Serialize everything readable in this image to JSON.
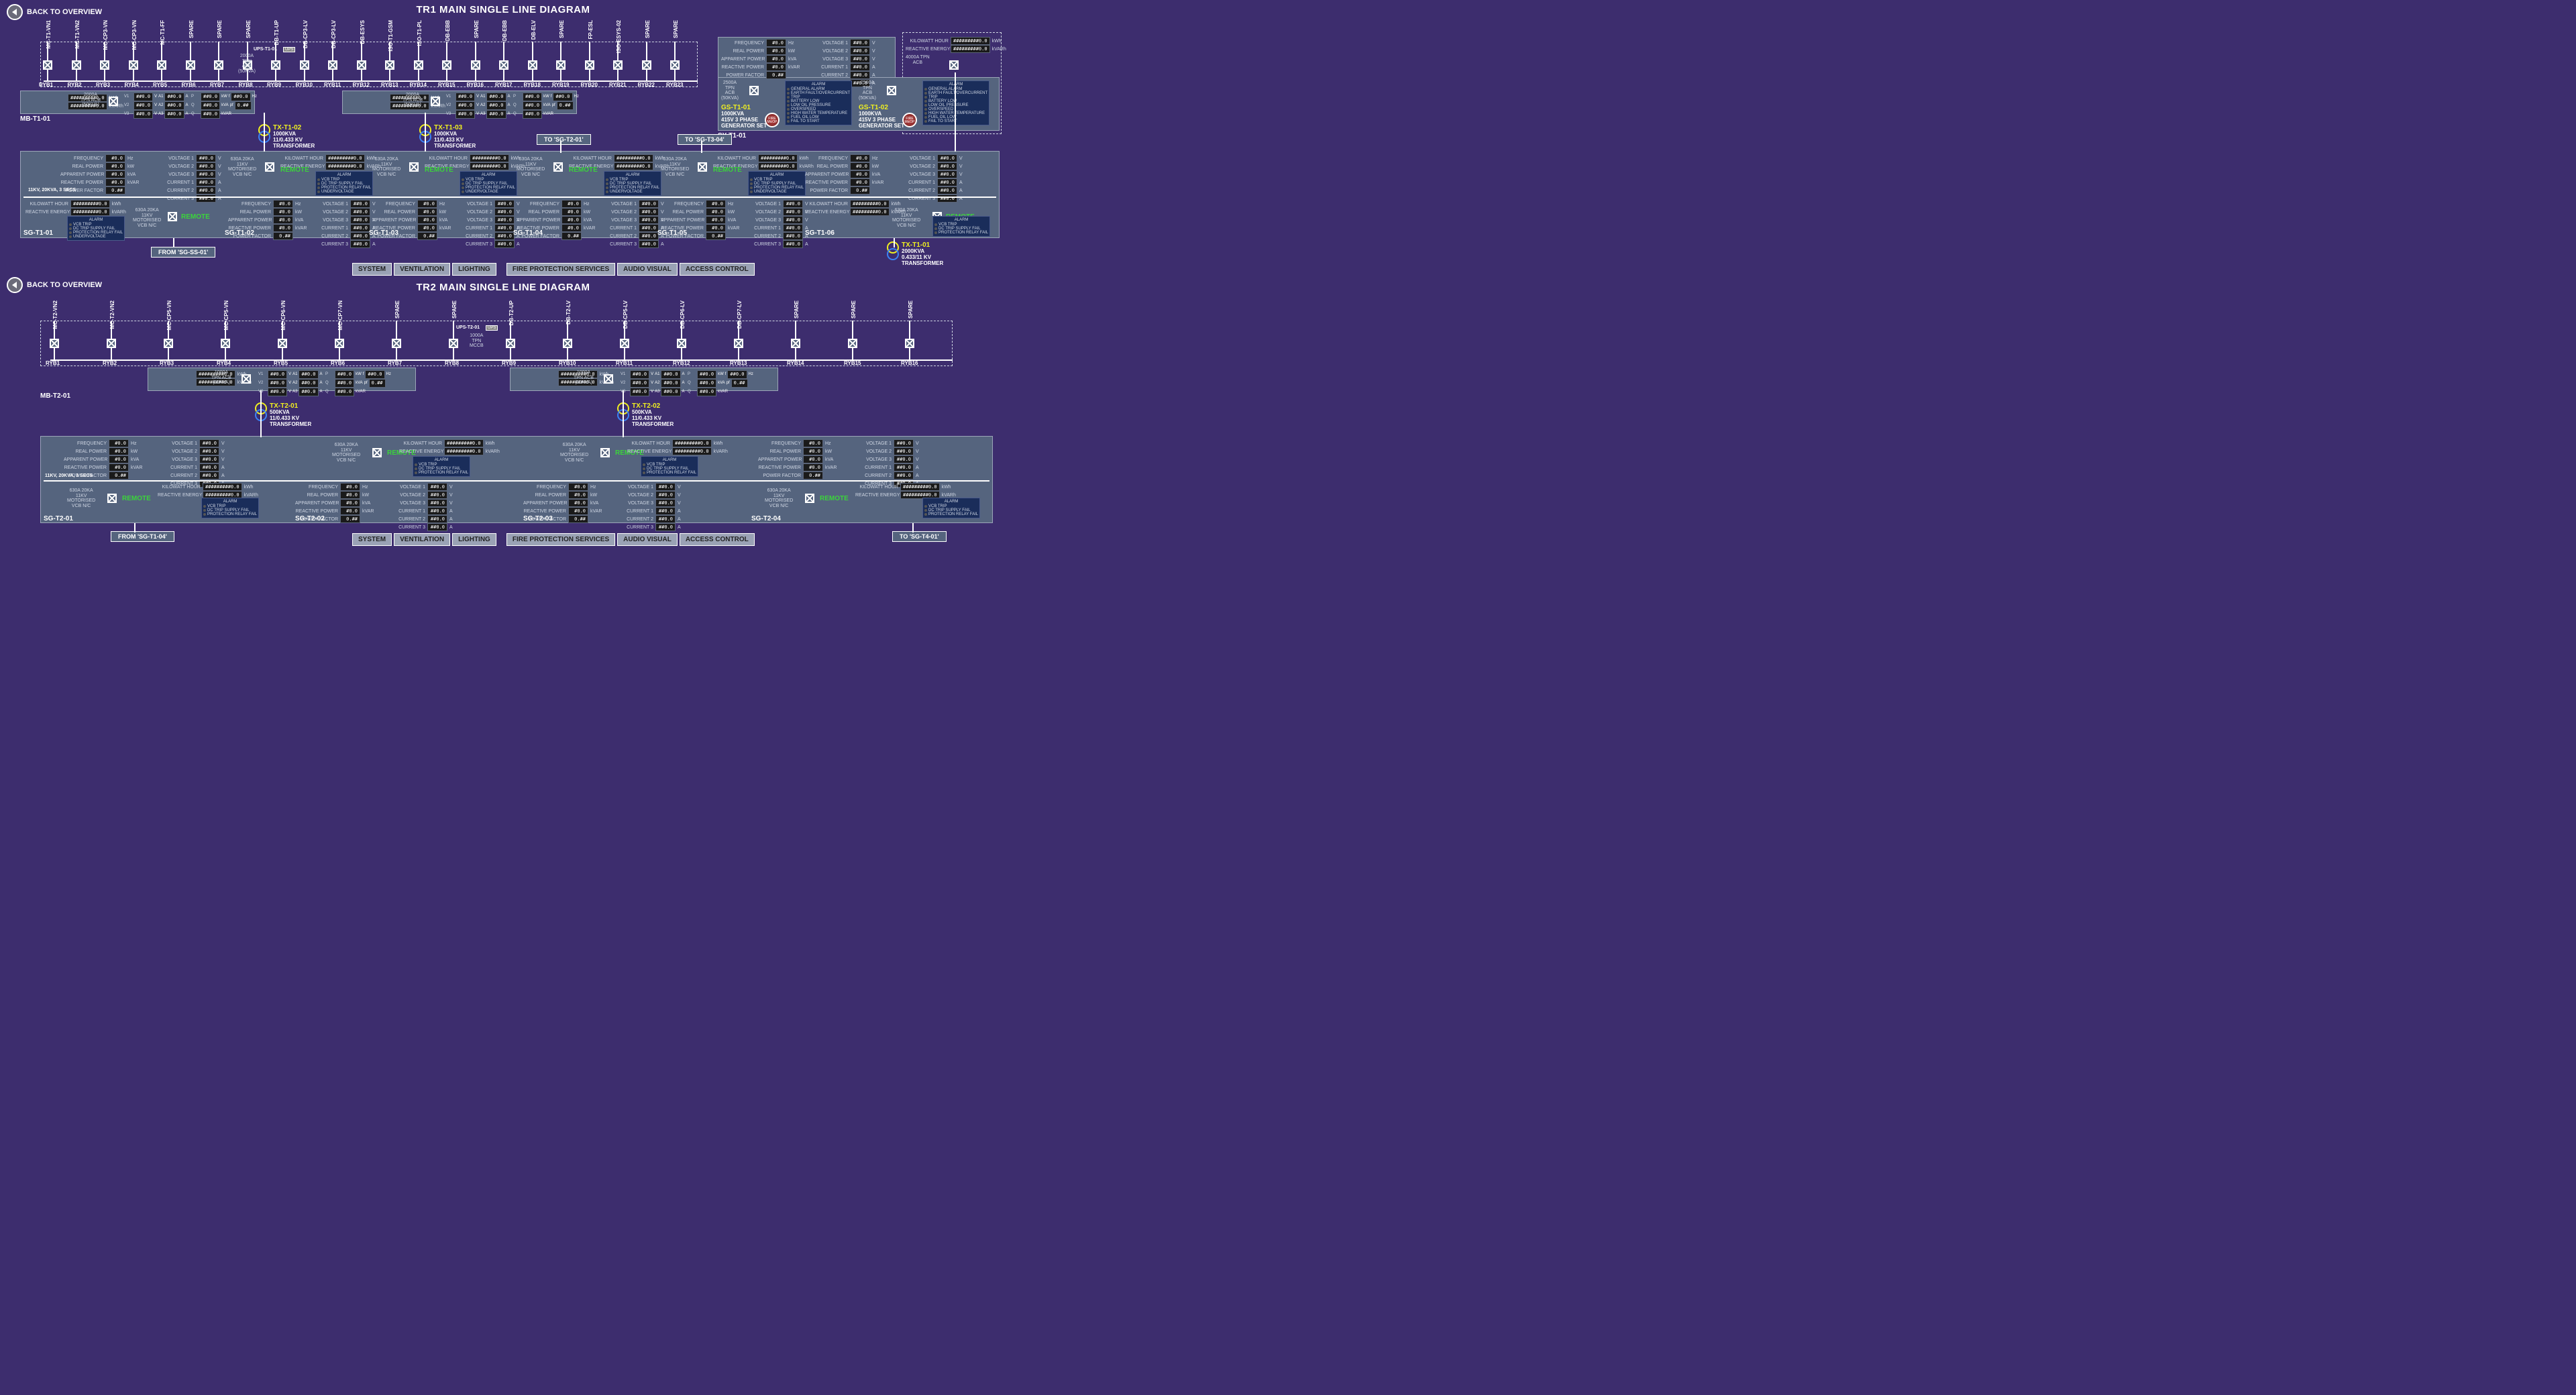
{
  "back_label": "BACK TO OVERVIEW",
  "titles": {
    "tr1": "TR1 MAIN SINGLE LINE DIAGRAM",
    "tr2": "TR2 MAIN SINGLE LINE DIAGRAM"
  },
  "nav": [
    "SYSTEM",
    "VENTILATION",
    "LIGHTING",
    "FIRE PROTECTION SERVICES",
    "AUDIO VISUAL",
    "ACCESS CONTROL"
  ],
  "feeders_tr1": [
    "MC-T1-VN1",
    "MC-T1-VN2",
    "MC-CP3-VN",
    "MC-CP3-VN",
    "MC-T1-FF",
    "SPARE",
    "SPARE",
    "SPARE",
    "DB-T1-UP",
    "DB-CP3-LV",
    "DB-CP3-LV",
    "DB-ESYS",
    "ISO-T1-GSM",
    "ISO-T1-PL",
    "DB-EBB",
    "SPARE",
    "DB-EBB",
    "DB-ELV",
    "SPARE",
    "FP-ESL",
    "ISO-ESYS-02",
    "SPARE",
    "SPARE"
  ],
  "ryb_tr1": [
    "RYB1",
    "RYB2",
    "RYB3",
    "RYB4",
    "RYB5",
    "RYB6",
    "RYB7",
    "RYB8",
    "RYB9",
    "RYB10",
    "RYB11",
    "RYB12",
    "RYB13",
    "RYB14",
    "RYB15",
    "RYB16",
    "RYB17",
    "RYB18",
    "RYB19",
    "RYB20",
    "RYB21",
    "RYB22",
    "RYB23"
  ],
  "feeders_tr2": [
    "MC-T2-VN2",
    "MC-T2-VN2",
    "MC-CP5-VN",
    "MC-CP5-VN",
    "MC-CP6-VN",
    "MC-CP7-VN",
    "SPARE",
    "SPARE",
    "DB-T2-UP",
    "DB-T2-LV",
    "DB-CP5-LV",
    "DB-CP6-LV",
    "DB-CP7-LV",
    "SPARE",
    "SPARE",
    "SPARE"
  ],
  "ryb_tr2": [
    "RYB1",
    "RYB2",
    "RYB3",
    "RYB4",
    "RYB5",
    "RYB6",
    "RYB7",
    "RYB8",
    "RYB9",
    "RYB10",
    "RYB11",
    "RYB12",
    "RYB13",
    "RYB14",
    "RYB15",
    "RYB16"
  ],
  "ups1": "UPS-T1-01",
  "ups2": "UPS-T2-01",
  "ups_badge": "UPS",
  "mb1": "MB-T1-01",
  "mb2": "MB-T2-01",
  "acb1": {
    "l1": "2000A",
    "l2": "TPN ACB",
    "l3": "(50KVA)"
  },
  "acb2": {
    "l1": "2000A",
    "l2": "TPN",
    "l3": "ACB",
    "l4": "(50KVA)"
  },
  "acb1000": {
    "l1": "1000A",
    "l2": "TPN ACB",
    "l3": "(50KVA)"
  },
  "mccb1000": {
    "l1": "1000A",
    "l2": "TPN",
    "l3": "MCCB"
  },
  "acb4000": {
    "l1": "4000A TPN",
    "l2": "ACB"
  },
  "acb2500": {
    "l1": "2500A",
    "l2": "TPN",
    "l3": "ACB",
    "l4": "(50KVA)"
  },
  "kwh_big": {
    "l1": "KILOWATT HOUR",
    "l2": "REACTIVE ENERGY",
    "v": "#########0.0",
    "u1": "kWh",
    "u2": "kVARh"
  },
  "volt3": {
    "v1": "##0.0",
    "v2": "##0.0",
    "v3": "##0.0"
  },
  "amp3": {
    "a1": "##0.0",
    "a2": "##0.0",
    "a3": "##0.0"
  },
  "pqf": {
    "p": "##0.0",
    "q": "##0.0",
    "f": "##0.0",
    "pf": "0.##"
  },
  "tx": {
    "t1_02": {
      "name": "TX-T1-02",
      "l1": "1000KVA",
      "l2": "11/0.433 KV",
      "l3": "TRANSFORMER"
    },
    "t1_03": {
      "name": "TX-T1-03",
      "l1": "1000KVA",
      "l2": "11/0.433 KV",
      "l3": "TRANSFORMER"
    },
    "t1_01": {
      "name": "TX-T1-01",
      "l1": "2000KVA",
      "l2": "0.433/11 KV",
      "l3": "TRANSFORMER"
    },
    "t2_01": {
      "name": "TX-T2-01",
      "l1": "500KVA",
      "l2": "11/0.433 KV",
      "l3": "TRANSFORMER"
    },
    "t2_02": {
      "name": "TX-T2-02",
      "l1": "500KVA",
      "l2": "11/0.433 KV",
      "l3": "TRANSFORMER"
    }
  },
  "power5": {
    "k1": "FREQUENCY",
    "k2": "REAL POWER",
    "k3": "APPARENT POWER",
    "k4": "REACTIVE POWER",
    "k5": "POWER FACTOR",
    "v1": "#0.0",
    "v2": "#0.0",
    "v3": "#0.0",
    "v4": "#0.0",
    "v5": "0.##",
    "u1": "Hz",
    "u2": "kW",
    "u3": "kVA",
    "u4": "kVAR",
    "u5": ""
  },
  "volt6": {
    "k1": "VOLTAGE 1",
    "k2": "VOLTAGE 2",
    "k3": "VOLTAGE 3",
    "k4": "CURRENT 1",
    "k5": "CURRENT 2",
    "k6": "CURRENT 3",
    "v": "##0.0",
    "uV": "V",
    "uA": "A"
  },
  "rating": "11KV, 20KVA, 3 SECS",
  "cb630": {
    "l1": "630A 20KA",
    "l2": "11KV",
    "l3": "MOTORISED",
    "l4": "VCB N/C"
  },
  "remote": "REMOTE",
  "alarm": {
    "hdr": "ALARM",
    "vcb": {
      "a1": "VCB TRIP",
      "a2": "DC TRIP SUPPLY FAIL",
      "a3": "PROTECTION RELAY FAIL"
    },
    "vcb4": {
      "a1": "VCB TRIP",
      "a2": "DC TRIP SUPPLY FAIL",
      "a3": "PROTECTION RELAY FAIL",
      "a4": "UNDERVOLTAGE"
    },
    "gen": {
      "a1": "GENERAL ALARM",
      "a2": "EARTH FAULT/OVERCURRENT",
      "a3": "TRIP",
      "a4": "BATTERY LOW",
      "a5": "LOW OIL PRESSURE",
      "a6": "OVERSPEED",
      "a7": "HIGH WATER TEMPERATURE",
      "a8": "FUEL OIL LOW",
      "a9": "FAIL TO START"
    }
  },
  "sg": {
    "t1": [
      "SG-T1-01",
      "SG-T1-02",
      "SG-T1-03",
      "SG-T1-04",
      "SG-T1-05",
      "SG-T1-06"
    ],
    "t2": [
      "SG-T2-01",
      "SG-T2-02",
      "SG-T2-03",
      "SG-T2-04"
    ]
  },
  "sy": "SY-T1-01",
  "gs": {
    "g1": {
      "name": "GS-T1-01",
      "l1": "1000KVA",
      "l2": "415V 3 PHASE",
      "l3": "GENERATOR SET"
    },
    "g2": {
      "name": "GS-T1-02",
      "l1": "1000KVA",
      "l2": "415V 3 PHASE",
      "l3": "GENERATOR SET"
    }
  },
  "fire": "FIRE MicOP",
  "tags": {
    "from_ss": "FROM 'SG-SS-01'",
    "to_t2": "TO 'SG-T2-01'",
    "to_t3": "TO 'SG-T3-04'",
    "from_t1": "FROM 'SG-T1-04'",
    "to_t4": "TO 'SG-T4-01'"
  }
}
